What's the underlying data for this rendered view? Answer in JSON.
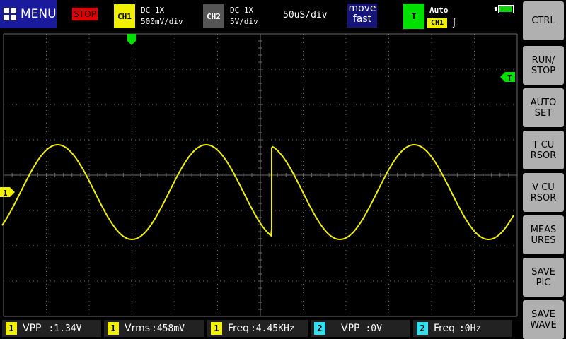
{
  "topbar": {
    "menu_label": "MENU",
    "run_state": "STOP",
    "ch1": {
      "badge": "CH1",
      "coupling": "DC  1X",
      "scale": "500mV/div",
      "color": "#f0f000"
    },
    "ch2": {
      "badge": "CH2",
      "coupling": "DC  1X",
      "scale": "5V/div",
      "color": "#555555"
    },
    "timebase": "50uS/div",
    "move_mode": {
      "line1": "move",
      "line2": "fast"
    },
    "trigger": {
      "badge": "T",
      "mode": "Auto",
      "source": "CH1",
      "edge": "ƒ",
      "color": "#00e000"
    },
    "battery_level": 1.0
  },
  "side_buttons": [
    {
      "id": "ctrl",
      "label": "CTRL"
    },
    {
      "id": "run-stop",
      "label": "RUN/\nSTOP"
    },
    {
      "id": "auto-set",
      "label": "AUTO\nSET"
    },
    {
      "id": "t-cursor",
      "label": "T CU\nRSOR"
    },
    {
      "id": "v-cursor",
      "label": "V CU\nRSOR"
    },
    {
      "id": "measures",
      "label": "MEAS\nURES"
    },
    {
      "id": "save-pic",
      "label": "SAVE\nPIC"
    },
    {
      "id": "save-wave",
      "label": "SAVE\nWAVE"
    }
  ],
  "markers": {
    "ch1_level_label": "1",
    "trigger_level_label": "T"
  },
  "measurements": [
    {
      "ch": "1",
      "label": "VPP",
      "value": ":1.34V",
      "color": "#f0f000"
    },
    {
      "ch": "1",
      "label": "Vrms",
      "value": ":458mV",
      "color": "#f0f000"
    },
    {
      "ch": "1",
      "label": "Freq",
      "value": ":4.45KHz",
      "color": "#f0f000"
    },
    {
      "ch": "2",
      "label": "VPP",
      "value": ":0V",
      "color": "#30e0f0"
    },
    {
      "ch": "2",
      "label": "Freq",
      "value": ":0Hz",
      "color": "#30e0f0"
    }
  ],
  "waveform": {
    "color": "#f0f000",
    "grid_color": "#6a6a6a"
  }
}
